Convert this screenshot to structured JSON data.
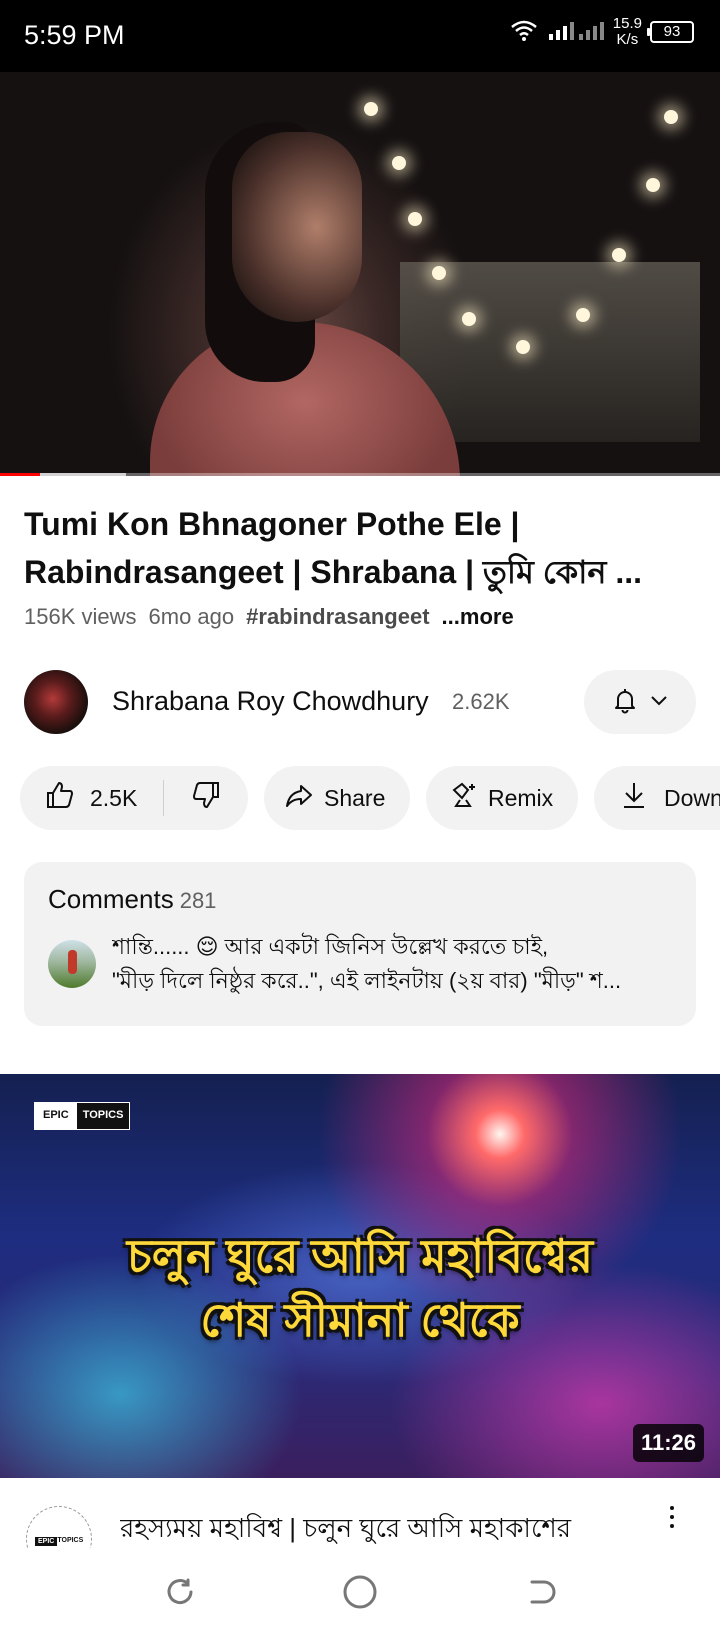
{
  "status": {
    "time": "5:59 PM",
    "speed_value": "15.9",
    "speed_unit": "K/s",
    "battery": "93"
  },
  "player": {
    "played_fraction": 0.055,
    "buffered_fraction": 0.175
  },
  "video": {
    "title": "Tumi Kon Bhnagoner Pothe Ele | Rabindrasangeet | Shrabana | তুমি কোন ...",
    "views": "156K views",
    "age": "6mo ago",
    "hashtag": "#rabindrasangeet",
    "more": "...more"
  },
  "channel": {
    "name": "Shrabana Roy Chowdhury",
    "subscribers": "2.62K"
  },
  "actions": {
    "likes": "2.5K",
    "share": "Share",
    "remix": "Remix",
    "download": "Down"
  },
  "comments": {
    "header": "Comments",
    "count": "281",
    "line1": "শান্তি...... 😌 আর একটা জিনিস উল্লেখ করতে চাই,",
    "line2": "\"মীড় দিলে নিষ্ঠুর করে..\", এই লাইনটায় (২য় বার) \"মীড়\" শ..."
  },
  "next_video": {
    "badge_left": "EPIC",
    "badge_right": "TOPICS",
    "thumb_line1": "চলুন ঘুরে আসি মহাবিশ্বের",
    "thumb_line2": "শেষ সীমানা থেকে",
    "duration": "11:26",
    "title": "রহস্যময় মহাবিশ্ব | চলুন ঘুরে আসি মহাকাশের"
  }
}
